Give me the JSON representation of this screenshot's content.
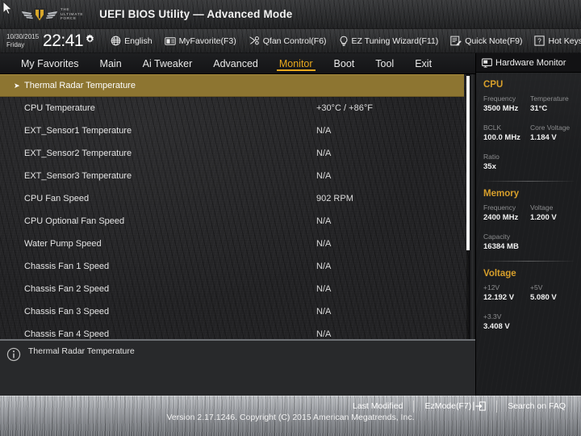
{
  "titlebar": {
    "logo_line1": "The",
    "logo_line2": "Ultimate",
    "logo_line3": "Force",
    "title": "UEFI BIOS Utility — Advanced Mode"
  },
  "toolbar": {
    "date": "10/30/2015",
    "weekday": "Friday",
    "time": "22:41",
    "items": [
      {
        "label": "English",
        "icon": "globe-icon"
      },
      {
        "label": "MyFavorite(F3)",
        "icon": "favorite-card-icon"
      },
      {
        "label": "Qfan Control(F6)",
        "icon": "qfan-icon"
      },
      {
        "label": "EZ Tuning Wizard(F11)",
        "icon": "lightbulb-icon"
      },
      {
        "label": "Quick Note(F9)",
        "icon": "note-icon"
      },
      {
        "label": "Hot Keys",
        "icon": "question-box-icon"
      }
    ]
  },
  "nav": {
    "tabs": [
      {
        "label": "My Favorites",
        "active": false
      },
      {
        "label": "Main",
        "active": false
      },
      {
        "label": "Ai Tweaker",
        "active": false
      },
      {
        "label": "Advanced",
        "active": false
      },
      {
        "label": "Monitor",
        "active": true
      },
      {
        "label": "Boot",
        "active": false
      },
      {
        "label": "Tool",
        "active": false
      },
      {
        "label": "Exit",
        "active": false
      }
    ],
    "active_color": "#e9a91d"
  },
  "main": {
    "rows": [
      {
        "label": "Thermal Radar Temperature",
        "value": "",
        "selected": true,
        "submenu": true
      },
      {
        "label": "CPU Temperature",
        "value": "+30°C / +86°F",
        "selected": false,
        "submenu": false
      },
      {
        "label": "EXT_Sensor1  Temperature",
        "value": "N/A",
        "selected": false,
        "submenu": false
      },
      {
        "label": "EXT_Sensor2  Temperature",
        "value": "N/A",
        "selected": false,
        "submenu": false
      },
      {
        "label": "EXT_Sensor3  Temperature",
        "value": "N/A",
        "selected": false,
        "submenu": false
      },
      {
        "label": "CPU Fan Speed",
        "value": "902 RPM",
        "selected": false,
        "submenu": false
      },
      {
        "label": "CPU Optional Fan Speed",
        "value": "N/A",
        "selected": false,
        "submenu": false
      },
      {
        "label": "Water Pump Speed",
        "value": "N/A",
        "selected": false,
        "submenu": false
      },
      {
        "label": "Chassis Fan 1 Speed",
        "value": "N/A",
        "selected": false,
        "submenu": false
      },
      {
        "label": "Chassis Fan 2 Speed",
        "value": "N/A",
        "selected": false,
        "submenu": false
      },
      {
        "label": "Chassis Fan 3 Speed",
        "value": "N/A",
        "selected": false,
        "submenu": false
      },
      {
        "label": "Chassis Fan 4 Speed",
        "value": "N/A",
        "selected": false,
        "submenu": false
      }
    ],
    "selected_bg": "#8d7531"
  },
  "help": {
    "icon": "info-icon",
    "text": "Thermal Radar Temperature"
  },
  "hardware_monitor": {
    "header": "Hardware Monitor",
    "header_icon": "monitor-icon",
    "sections": [
      {
        "title": "CPU",
        "pairs": [
          [
            {
              "key": "Frequency",
              "value": "3500 MHz"
            },
            {
              "key": "Temperature",
              "value": "31°C"
            }
          ],
          [
            {
              "key": "BCLK",
              "value": "100.0 MHz"
            },
            {
              "key": "Core Voltage",
              "value": "1.184 V"
            }
          ],
          [
            {
              "key": "Ratio",
              "value": "35x"
            }
          ]
        ]
      },
      {
        "title": "Memory",
        "pairs": [
          [
            {
              "key": "Frequency",
              "value": "2400 MHz"
            },
            {
              "key": "Voltage",
              "value": "1.200 V"
            }
          ],
          [
            {
              "key": "Capacity",
              "value": "16384 MB"
            }
          ]
        ]
      },
      {
        "title": "Voltage",
        "pairs": [
          [
            {
              "key": "+12V",
              "value": "12.192 V"
            },
            {
              "key": "+5V",
              "value": "5.080 V"
            }
          ],
          [
            {
              "key": "+3.3V",
              "value": "3.408 V"
            }
          ]
        ]
      }
    ],
    "accent_color": "#d79f2b"
  },
  "footer": {
    "last_modified": "Last Modified",
    "ez_mode": "EzMode(F7)",
    "search_faq": "Search on FAQ",
    "version": "Version 2.17.1246. Copyright (C) 2015 American Megatrends, Inc."
  }
}
